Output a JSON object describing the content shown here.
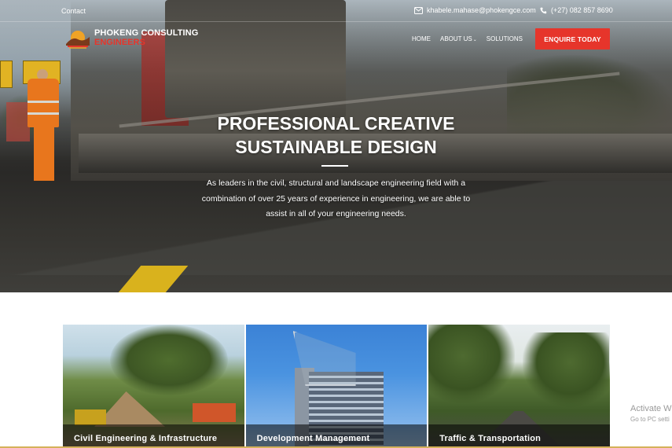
{
  "topbar": {
    "contact": "Contact",
    "email": "khabele.mahase@phokengce.com",
    "phone": "(+27) 082 857 8690"
  },
  "brand": {
    "line1": "PHOKENG CONSULTING",
    "line2": "ENGINEERS"
  },
  "nav": {
    "items": [
      {
        "label": "HOME"
      },
      {
        "label": "ABOUT US"
      },
      {
        "label": "SOLUTIONS"
      }
    ],
    "cta": "ENQUIRE TODAY"
  },
  "hero": {
    "title_line1": "PROFESSIONAL CREATIVE",
    "title_line2": "SUSTAINABLE DESIGN",
    "subtitle": "As leaders in the civil, structural and landscape engineering field with a combination of over 25 years of experience in engineering, we are able to assist in all of your engineering needs."
  },
  "services": [
    {
      "label": "Civil Engineering & Infrastructure"
    },
    {
      "label": "Development Management"
    },
    {
      "label": "Traffic & Transportation"
    }
  ],
  "watermark": {
    "line1": "Activate W",
    "line2": "Go to PC setti"
  },
  "colors": {
    "accent": "#e6352b",
    "text_light": "#ffffff"
  },
  "icons": {
    "email": "envelope-icon",
    "phone": "phone-icon",
    "logo": "phokeng-logo-icon",
    "caret": "chevron-down-icon"
  }
}
